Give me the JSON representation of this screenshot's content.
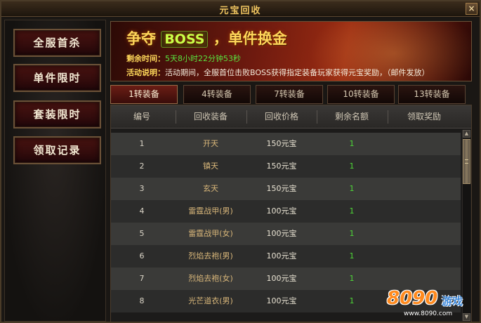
{
  "window": {
    "title": "元宝回收",
    "close_label": "×"
  },
  "sidebar": {
    "items": [
      {
        "label": "全服首杀"
      },
      {
        "label": "单件限时"
      },
      {
        "label": "套装限时"
      },
      {
        "label": "领取记录"
      }
    ]
  },
  "banner": {
    "headline_pre": "争夺",
    "headline_boss": "BOSS",
    "headline_post": "，单件换金",
    "time_label": "剩余时间：",
    "time_value": "5天8小时22分钟53秒",
    "desc_label": "活动说明：",
    "desc_value": "活动期间，全服首位击败BOSS获得指定装备玩家获得元宝奖励，（邮件发放）"
  },
  "tabs": [
    {
      "label": "1转装备",
      "active": true
    },
    {
      "label": "4转装备",
      "active": false
    },
    {
      "label": "7转装备",
      "active": false
    },
    {
      "label": "10转装备",
      "active": false
    },
    {
      "label": "13转装备",
      "active": false
    }
  ],
  "table": {
    "columns": [
      "编号",
      "回收装备",
      "回收价格",
      "剩余名额",
      "领取奖励"
    ],
    "rows": [
      {
        "id": "1",
        "item": "开天",
        "price": "150元宝",
        "remaining": "1",
        "reward": ""
      },
      {
        "id": "2",
        "item": "镇天",
        "price": "150元宝",
        "remaining": "1",
        "reward": ""
      },
      {
        "id": "3",
        "item": "玄天",
        "price": "150元宝",
        "remaining": "1",
        "reward": ""
      },
      {
        "id": "4",
        "item": "雷霆战甲(男)",
        "price": "100元宝",
        "remaining": "1",
        "reward": ""
      },
      {
        "id": "5",
        "item": "雷霆战甲(女)",
        "price": "100元宝",
        "remaining": "1",
        "reward": ""
      },
      {
        "id": "6",
        "item": "烈焰去袍(男)",
        "price": "100元宝",
        "remaining": "1",
        "reward": ""
      },
      {
        "id": "7",
        "item": "烈焰去袍(女)",
        "price": "100元宝",
        "remaining": "1",
        "reward": ""
      },
      {
        "id": "8",
        "item": "光芒道衣(男)",
        "price": "100元宝",
        "remaining": "1",
        "reward": ""
      }
    ]
  },
  "scrollbar": {
    "up_icon": "scroll-up-arrow",
    "down_icon": "scroll-down-arrow"
  },
  "watermark": {
    "logo": "8090",
    "text": "游戏",
    "url": "www.8090.com"
  },
  "colors": {
    "title_gold": "#f0c560",
    "item_text": "#d9b77a",
    "remaining_green": "#4fd838",
    "tab_active": "#6a1d15",
    "button_red": "#4a1310"
  }
}
